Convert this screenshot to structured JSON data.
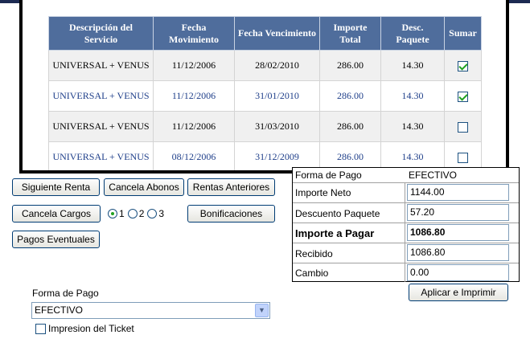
{
  "table": {
    "headers": [
      "Descripción del Servicio",
      "Fecha Movimiento",
      "Fecha Vencimiento",
      "Importe Total",
      "Desc. Paquete",
      "Sumar"
    ],
    "rows": [
      {
        "descripcion": "UNIVERSAL + VENUS",
        "fecha_movimiento": "11/12/2006",
        "fecha_vencimiento": "28/02/2010",
        "importe_total": "286.00",
        "desc_paquete": "14.30",
        "sumar": true
      },
      {
        "descripcion": "UNIVERSAL + VENUS",
        "fecha_movimiento": "11/12/2006",
        "fecha_vencimiento": "31/01/2010",
        "importe_total": "286.00",
        "desc_paquete": "14.30",
        "sumar": true
      },
      {
        "descripcion": "UNIVERSAL + VENUS",
        "fecha_movimiento": "11/12/2006",
        "fecha_vencimiento": "31/03/2010",
        "importe_total": "286.00",
        "desc_paquete": "14.30",
        "sumar": false
      },
      {
        "descripcion": "UNIVERSAL + VENUS",
        "fecha_movimiento": "08/12/2006",
        "fecha_vencimiento": "31/12/2009",
        "importe_total": "286.00",
        "desc_paquete": "14.30",
        "sumar": false
      }
    ]
  },
  "buttons": {
    "siguiente_renta": "Siguiente Renta",
    "cancela_abonos": "Cancela Abonos",
    "rentas_anteriores": "Rentas Anteriores",
    "cancela_cargos": "Cancela Cargos",
    "bonificaciones": "Bonificaciones",
    "pagos_eventuales": "Pagos Eventuales",
    "aplicar_imprimir": "Aplicar e Imprimir"
  },
  "radio": {
    "options": [
      "1",
      "2",
      "3"
    ],
    "selected": "1"
  },
  "payment": {
    "forma_pago_label": "Forma de Pago",
    "forma_pago_value": "EFECTIVO",
    "importe_neto_label": "Importe Neto",
    "importe_neto_value": "1144.00",
    "descuento_paquete_label": "Descuento Paquete",
    "descuento_paquete_value": "57.20",
    "importe_pagar_label": "Importe a Pagar",
    "importe_pagar_value": "1086.80",
    "recibido_label": "Recibido",
    "recibido_value": "1086.80",
    "cambio_label": "Cambio",
    "cambio_value": "0.00"
  },
  "forma_pago": {
    "label": "Forma de Pago",
    "selected": "EFECTIVO"
  },
  "ticket": {
    "label": "Impresion del Ticket",
    "checked": false
  },
  "colors": {
    "header_bg": "#4f6d9c",
    "accent_text": "#1f3f8a",
    "check_green": "#21a121"
  }
}
